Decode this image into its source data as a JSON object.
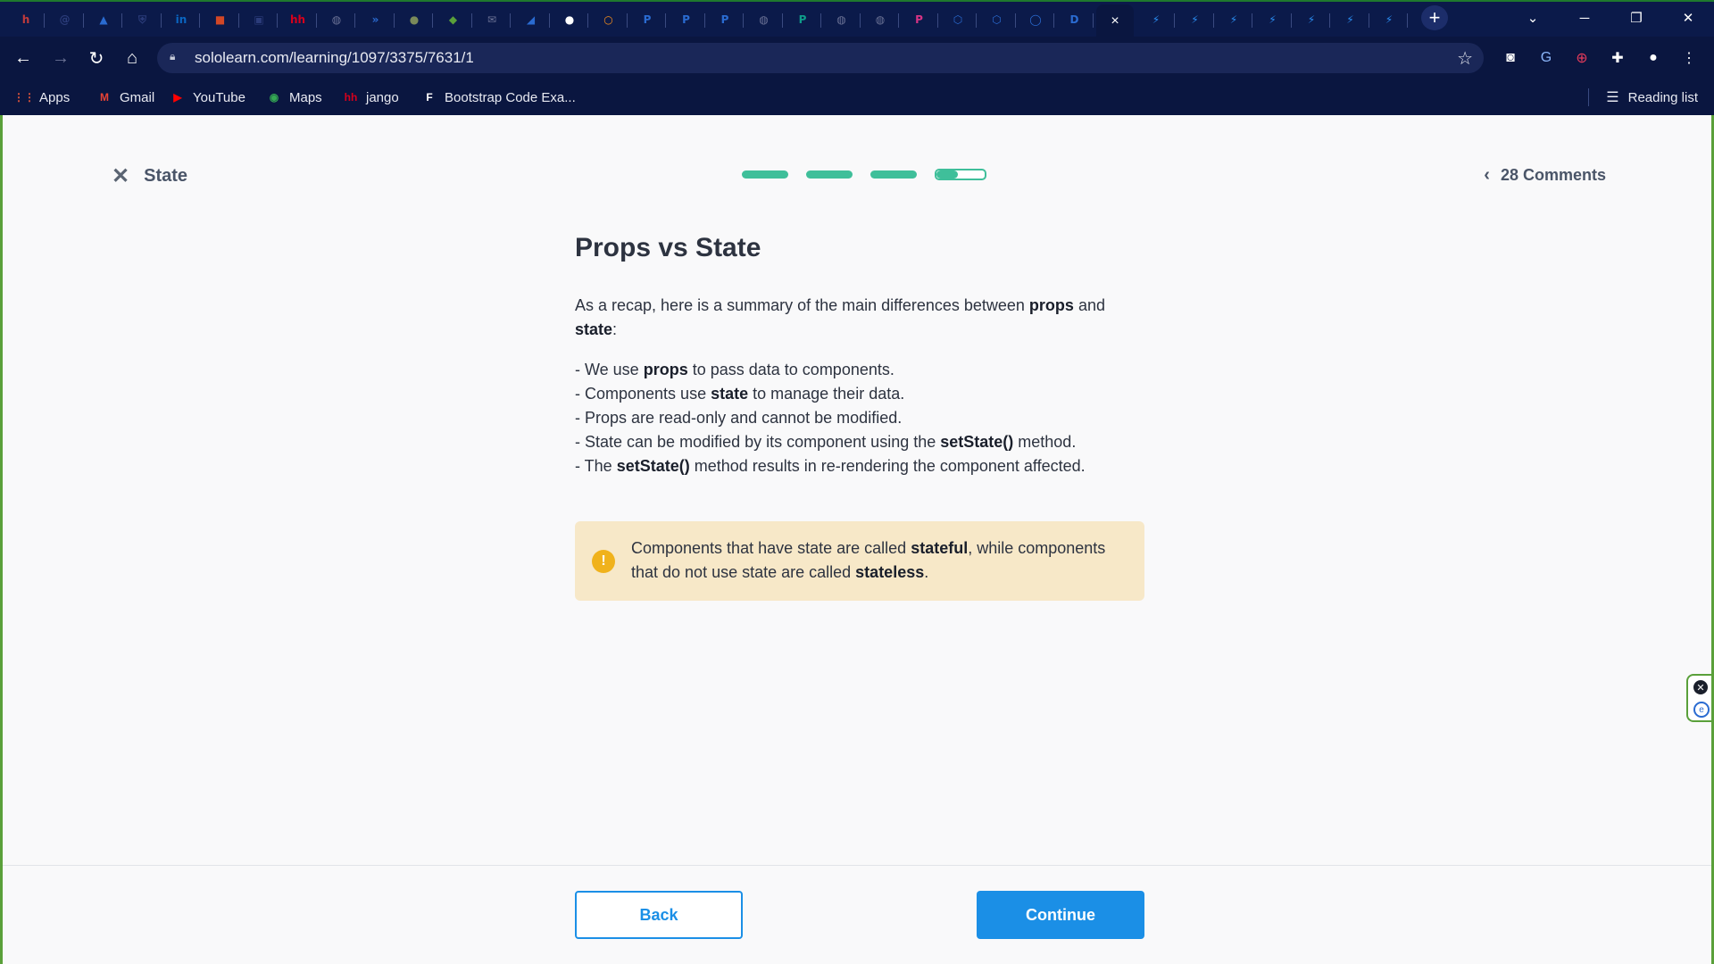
{
  "browser": {
    "tabs": [
      {
        "icon": "hh-icon",
        "glyph": "h",
        "color": "#c23b3b"
      },
      {
        "icon": "at-icon",
        "glyph": "@",
        "color": "#2b3c7a"
      },
      {
        "icon": "atlassian-icon",
        "glyph": "▲",
        "color": "#2a6bd1"
      },
      {
        "icon": "shield-icon",
        "glyph": "⛨",
        "color": "#2b3c7a"
      },
      {
        "icon": "linkedin-icon",
        "glyph": "in",
        "color": "#0a66c2"
      },
      {
        "icon": "office-icon",
        "glyph": "■",
        "color": "#d24726"
      },
      {
        "icon": "presentation-icon",
        "glyph": "▣",
        "color": "#2b3c7a"
      },
      {
        "icon": "hh-icon",
        "glyph": "hh",
        "color": "#d6001c"
      },
      {
        "icon": "globe-icon",
        "glyph": "◍",
        "color": "#6c7396"
      },
      {
        "icon": "jira-icon",
        "glyph": "»",
        "color": "#2a6bd1"
      },
      {
        "icon": "avatar-icon",
        "glyph": "●",
        "color": "#7a8a5a"
      },
      {
        "icon": "box-icon",
        "glyph": "◆",
        "color": "#5aa03a"
      },
      {
        "icon": "gmail-icon",
        "glyph": "✉",
        "color": "#6c7396"
      },
      {
        "icon": "netlify-icon",
        "glyph": "◢",
        "color": "#2a6bd1"
      },
      {
        "icon": "github-icon",
        "glyph": "●",
        "color": "#ffffff"
      },
      {
        "icon": "circle-icon",
        "glyph": "○",
        "color": "#f28c1c"
      },
      {
        "icon": "paypal-icon",
        "glyph": "P",
        "color": "#2a6bd1"
      },
      {
        "icon": "paypal-icon",
        "glyph": "P",
        "color": "#2a6bd1"
      },
      {
        "icon": "paypal-icon",
        "glyph": "P",
        "color": "#2a6bd1"
      },
      {
        "icon": "globe-icon",
        "glyph": "◍",
        "color": "#6c7396"
      },
      {
        "icon": "p-icon",
        "glyph": "P",
        "color": "#0f9d8a"
      },
      {
        "icon": "globe-icon",
        "glyph": "◍",
        "color": "#6c7396"
      },
      {
        "icon": "globe-icon",
        "glyph": "◍",
        "color": "#6c7396"
      },
      {
        "icon": "p-icon",
        "glyph": "P",
        "color": "#d63384"
      },
      {
        "icon": "hex-icon",
        "glyph": "⬡",
        "color": "#2a6bd1"
      },
      {
        "icon": "hex-icon",
        "glyph": "⬡",
        "color": "#2a6bd1"
      },
      {
        "icon": "ring-icon",
        "glyph": "◯",
        "color": "#2a6bd1"
      },
      {
        "icon": "d-icon",
        "glyph": "D",
        "color": "#2a6bd1"
      }
    ],
    "active_tab_close": "×",
    "lightning_tabs": 7,
    "url": "sololearn.com/learning/1097/3375/7631/1",
    "bookmarks": [
      {
        "label": "Apps",
        "icon": "apps-grid-icon",
        "glyph": "⋮⋮",
        "color": "#e5573b"
      },
      {
        "label": "Gmail",
        "icon": "gmail-icon",
        "glyph": "M",
        "color": "#ea4335"
      },
      {
        "label": "YouTube",
        "icon": "youtube-icon",
        "glyph": "▶",
        "color": "#ff0000"
      },
      {
        "label": "Maps",
        "icon": "maps-pin-icon",
        "glyph": "◉",
        "color": "#34a853"
      },
      {
        "label": "jango",
        "icon": "hh-icon",
        "glyph": "hh",
        "color": "#d6001c"
      },
      {
        "label": "Bootstrap Code Exa...",
        "icon": "bootstrap-icon",
        "glyph": "F",
        "color": "#ffffff"
      }
    ],
    "reading_list": "Reading list"
  },
  "lesson": {
    "topic": "State",
    "comments": "28 Comments",
    "progress_segments": 4,
    "current_segment_fill": 0.45,
    "title": "Props vs State",
    "intro": [
      {
        "t": "As a recap, here is a summary of the main differences between "
      },
      {
        "t": "props",
        "b": true
      },
      {
        "t": " and "
      },
      {
        "t": "state",
        "b": true
      },
      {
        "t": ":"
      }
    ],
    "points": [
      [
        {
          "t": "- We use "
        },
        {
          "t": "props",
          "b": true
        },
        {
          "t": " to pass data to components."
        }
      ],
      [
        {
          "t": "- Components use "
        },
        {
          "t": "state",
          "b": true
        },
        {
          "t": " to manage their data."
        }
      ],
      [
        {
          "t": "- Props are read-only and cannot be modified."
        }
      ],
      [
        {
          "t": "- State can be modified by its component using the "
        },
        {
          "t": "setState()",
          "b": true
        },
        {
          "t": " method."
        }
      ],
      [
        {
          "t": "- The "
        },
        {
          "t": "setState()",
          "b": true
        },
        {
          "t": " method results in re-rendering the component affected."
        }
      ]
    ],
    "note": [
      {
        "t": "Components that have state are called "
      },
      {
        "t": "stateful",
        "b": true
      },
      {
        "t": ", while components that do not use state are called "
      },
      {
        "t": "stateless",
        "b": true
      },
      {
        "t": "."
      }
    ],
    "back_label": "Back",
    "continue_label": "Continue"
  }
}
